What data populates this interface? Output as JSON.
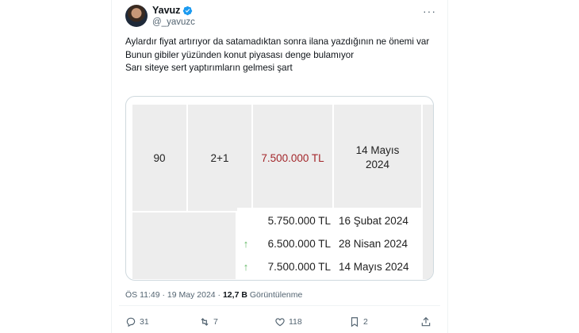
{
  "tweet": {
    "author_name": "Yavuz",
    "author_handle": "@_yavuzc",
    "lines": [
      "Aylardır fiyat artırıyor da satamadıktan sonra ilana yazdığının ne önemi var",
      "Bunun gibiler yüzünden konut piyasası denge bulamıyor",
      "Sarı siteye sert yaptırımların gelmesi şart"
    ],
    "time": "ÖS 11:49 · 19 May 2024 · ",
    "views_count": "12,7 B",
    "views_label": " Görüntülenme"
  },
  "listing": {
    "area": "90",
    "rooms": "2+1",
    "price": "7.500.000 TL",
    "date_line1": "14 Mayıs",
    "date_line2": "2024",
    "price_color": "#a3262a",
    "history": [
      {
        "arrow": "",
        "price": "5.750.000 TL",
        "date": "16 Şubat 2024"
      },
      {
        "arrow": "↑",
        "price": "6.500.000 TL",
        "date": "28 Nisan 2024"
      },
      {
        "arrow": "↑",
        "price": "7.500.000 TL",
        "date": "14 Mayıs 2024"
      }
    ]
  },
  "actions": {
    "replies": "31",
    "retweets": "7",
    "likes": "118",
    "bookmarks": "2"
  },
  "colors": {
    "verified": "#1d9bf0",
    "secondary_text": "#536471",
    "up_arrow": "#5fb862"
  }
}
